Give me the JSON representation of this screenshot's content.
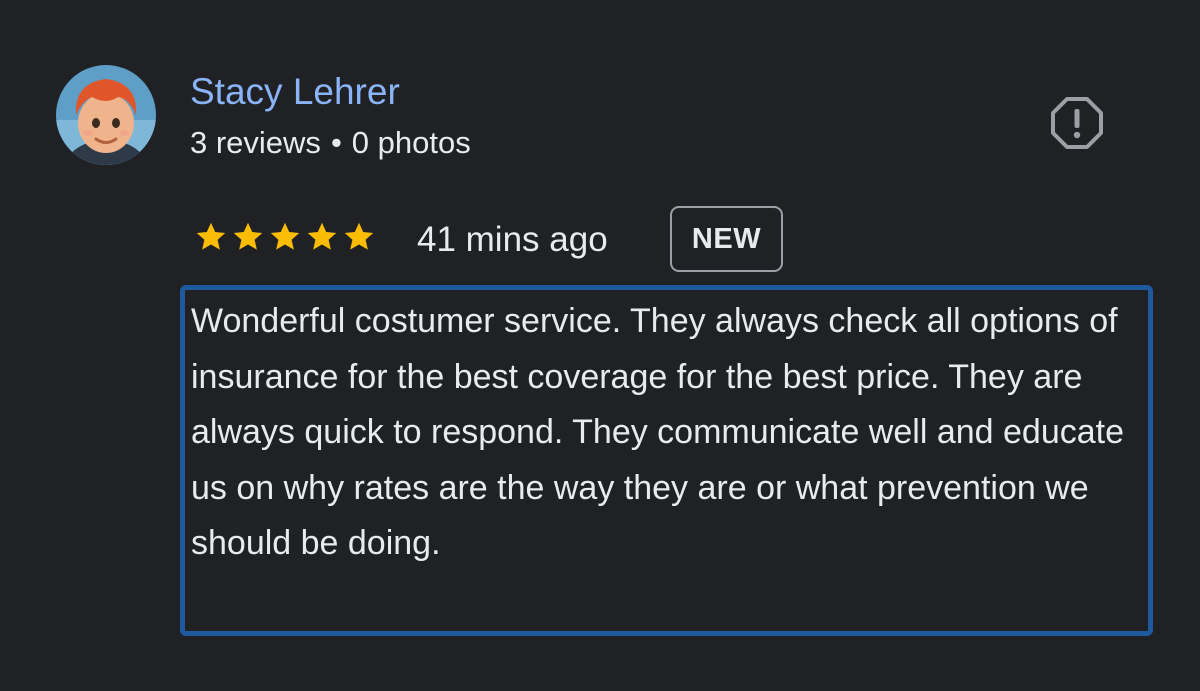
{
  "reviewer": {
    "name": "Stacy Lehrer",
    "reviews_count": "3 reviews",
    "separator": "•",
    "photos_count": "0 photos",
    "avatar_icon": "cartoon-avatar"
  },
  "report": {
    "icon": "report-flag-icon"
  },
  "rating": {
    "stars": 5,
    "max_stars": 5,
    "star_color": "#fbbc04"
  },
  "timestamp": "41 mins ago",
  "badge": "NEW",
  "review_text": "Wonderful costumer service. They always check all options of insurance for the best coverage for the best price. They are always quick to respond. They communicate well and educate us on why rates are the way they are or what prevention we should be doing.",
  "colors": {
    "background": "#202124",
    "name_link": "#8ab4f8",
    "text": "#e8eaed",
    "highlight_border": "#1e5a9e"
  }
}
